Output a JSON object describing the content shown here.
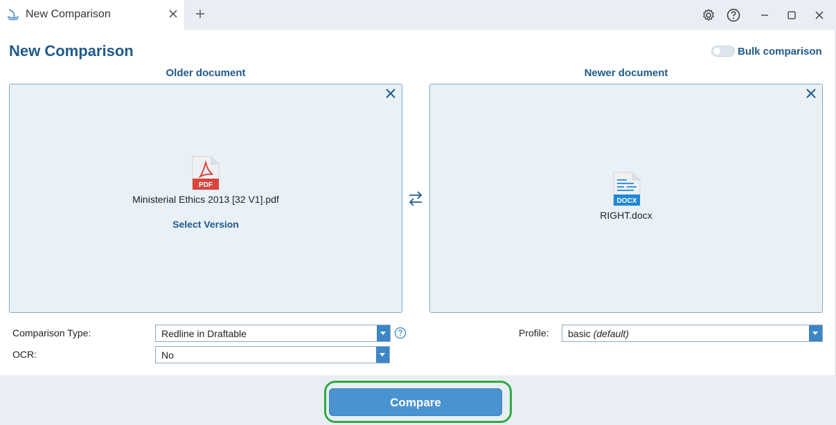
{
  "tab": {
    "title": "New Comparison",
    "icon": "draftable-logo-icon"
  },
  "header": {
    "title": "New Comparison",
    "bulk_label": "Bulk comparison",
    "bulk_enabled": false
  },
  "older": {
    "label": "Older document",
    "file_name": "Ministerial Ethics 2013 [32 V1].pdf",
    "file_type": "PDF",
    "select_version": "Select Version"
  },
  "newer": {
    "label": "Newer document",
    "file_name": "RIGHT.docx",
    "file_type": "DOCX"
  },
  "options": {
    "comparison_type_label": "Comparison Type:",
    "comparison_type_value": "Redline in Draftable",
    "ocr_label": "OCR:",
    "ocr_value": "No",
    "profile_label": "Profile:",
    "profile_value": "basic",
    "profile_suffix": "(default)"
  },
  "footer": {
    "compare_label": "Compare"
  },
  "colors": {
    "accent": "#1f5a8c",
    "button": "#4a93d1",
    "highlight": "#2eaa3e",
    "pdf": "#d9453b",
    "docx": "#1e88d6"
  }
}
